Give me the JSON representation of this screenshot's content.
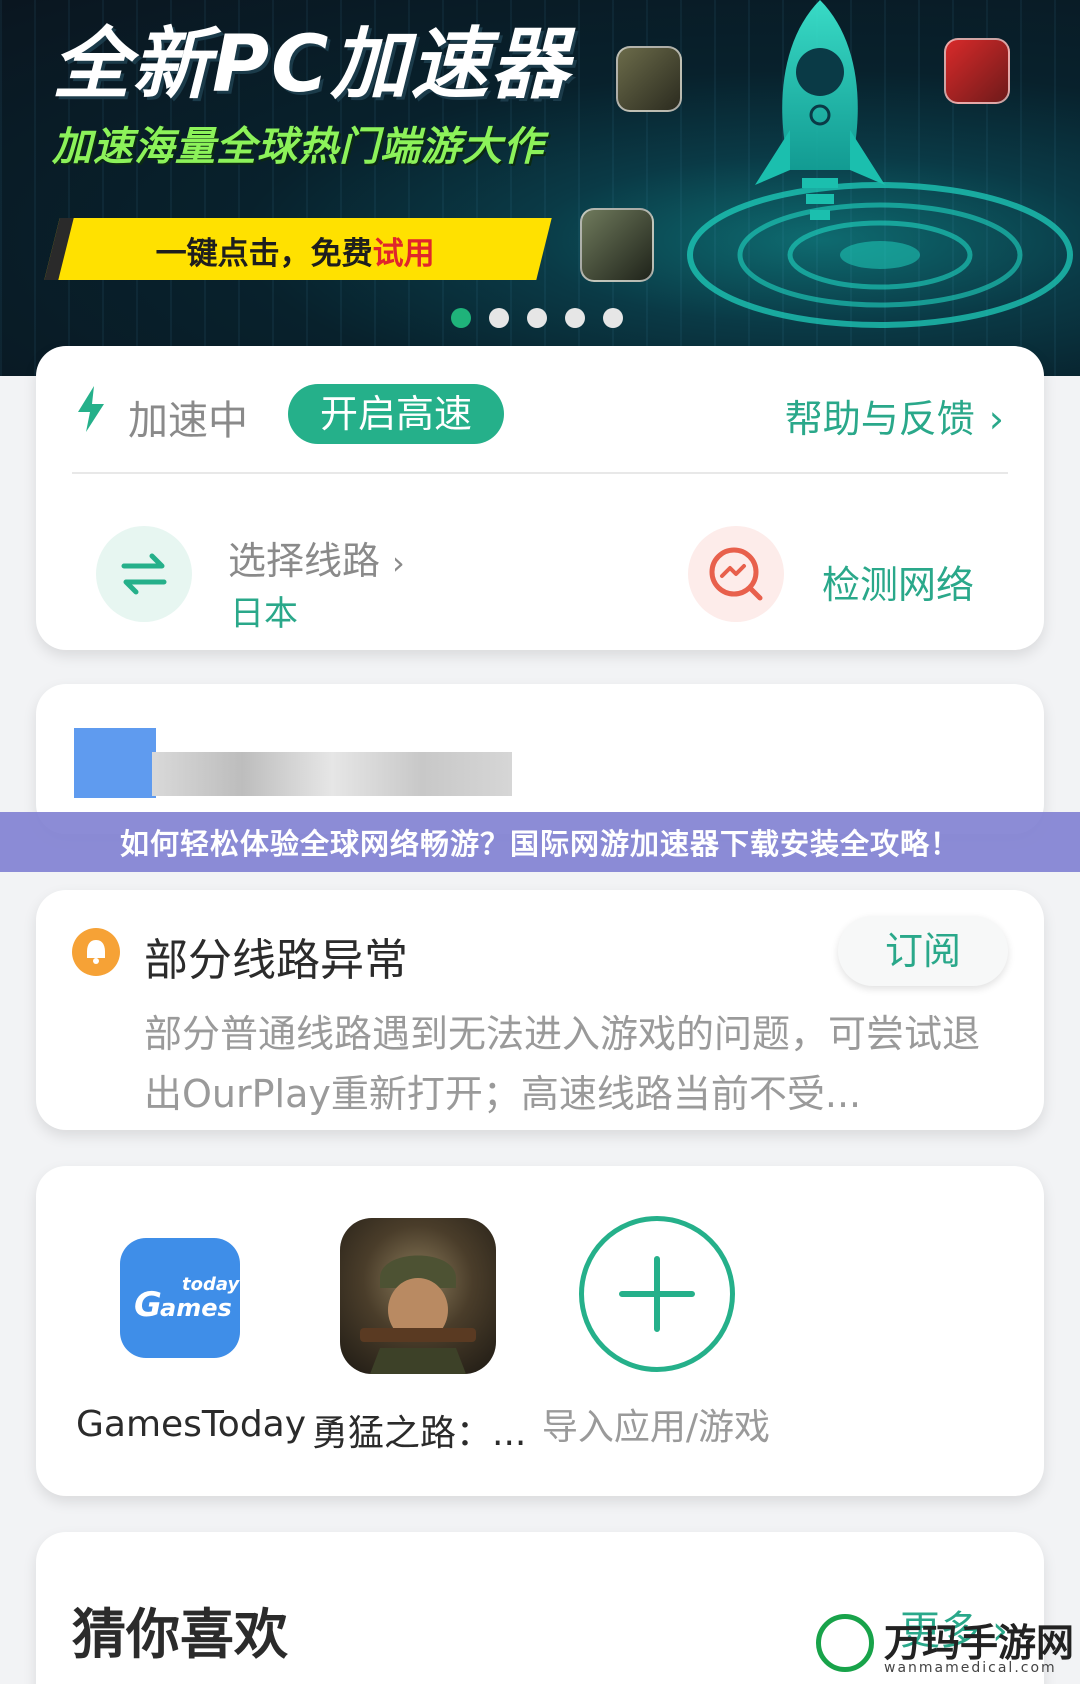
{
  "banner": {
    "title": "全新PC加速器",
    "subtitle": "加速海量全球热门端游大作",
    "cta_prefix": "一键点击，免费",
    "cta_highlight": "试用",
    "carousel_dots": 5,
    "active_dot": 0,
    "colors": {
      "cta_bg": "#ffe100",
      "subtitle": "#8cf25a",
      "active_dot": "#1fb37a"
    }
  },
  "status": {
    "state_label": "加速中",
    "boost_button": "开启高速",
    "help_link": "帮助与反馈",
    "route_label": "选择线路",
    "route_value": "日本",
    "detect_label": "检测网络"
  },
  "overlay_title": "如何轻松体验全球网络畅游？国际网游加速器下载安装全攻略！",
  "notice": {
    "title": "部分线路异常",
    "subscribe_button": "订阅",
    "body": "部分普通线路遇到无法进入游戏的问题，可尝试退出OurPlay重新打开；高速线路当前不受..."
  },
  "apps": [
    {
      "label": "GamesToday",
      "icon": "gamestoday-icon"
    },
    {
      "label": "勇猛之路：...",
      "icon": "soldier-game-icon"
    },
    {
      "label": "导入应用/游戏",
      "icon": "add-icon"
    }
  ],
  "recommend": {
    "title": "猜你喜欢",
    "more": "更多"
  },
  "watermark": {
    "name": "万玛手游网",
    "url": "wanmamedical.com"
  },
  "theme": {
    "accent": "#25b08a",
    "accent_text": "#2aa88a",
    "warning": "#f6a236"
  }
}
